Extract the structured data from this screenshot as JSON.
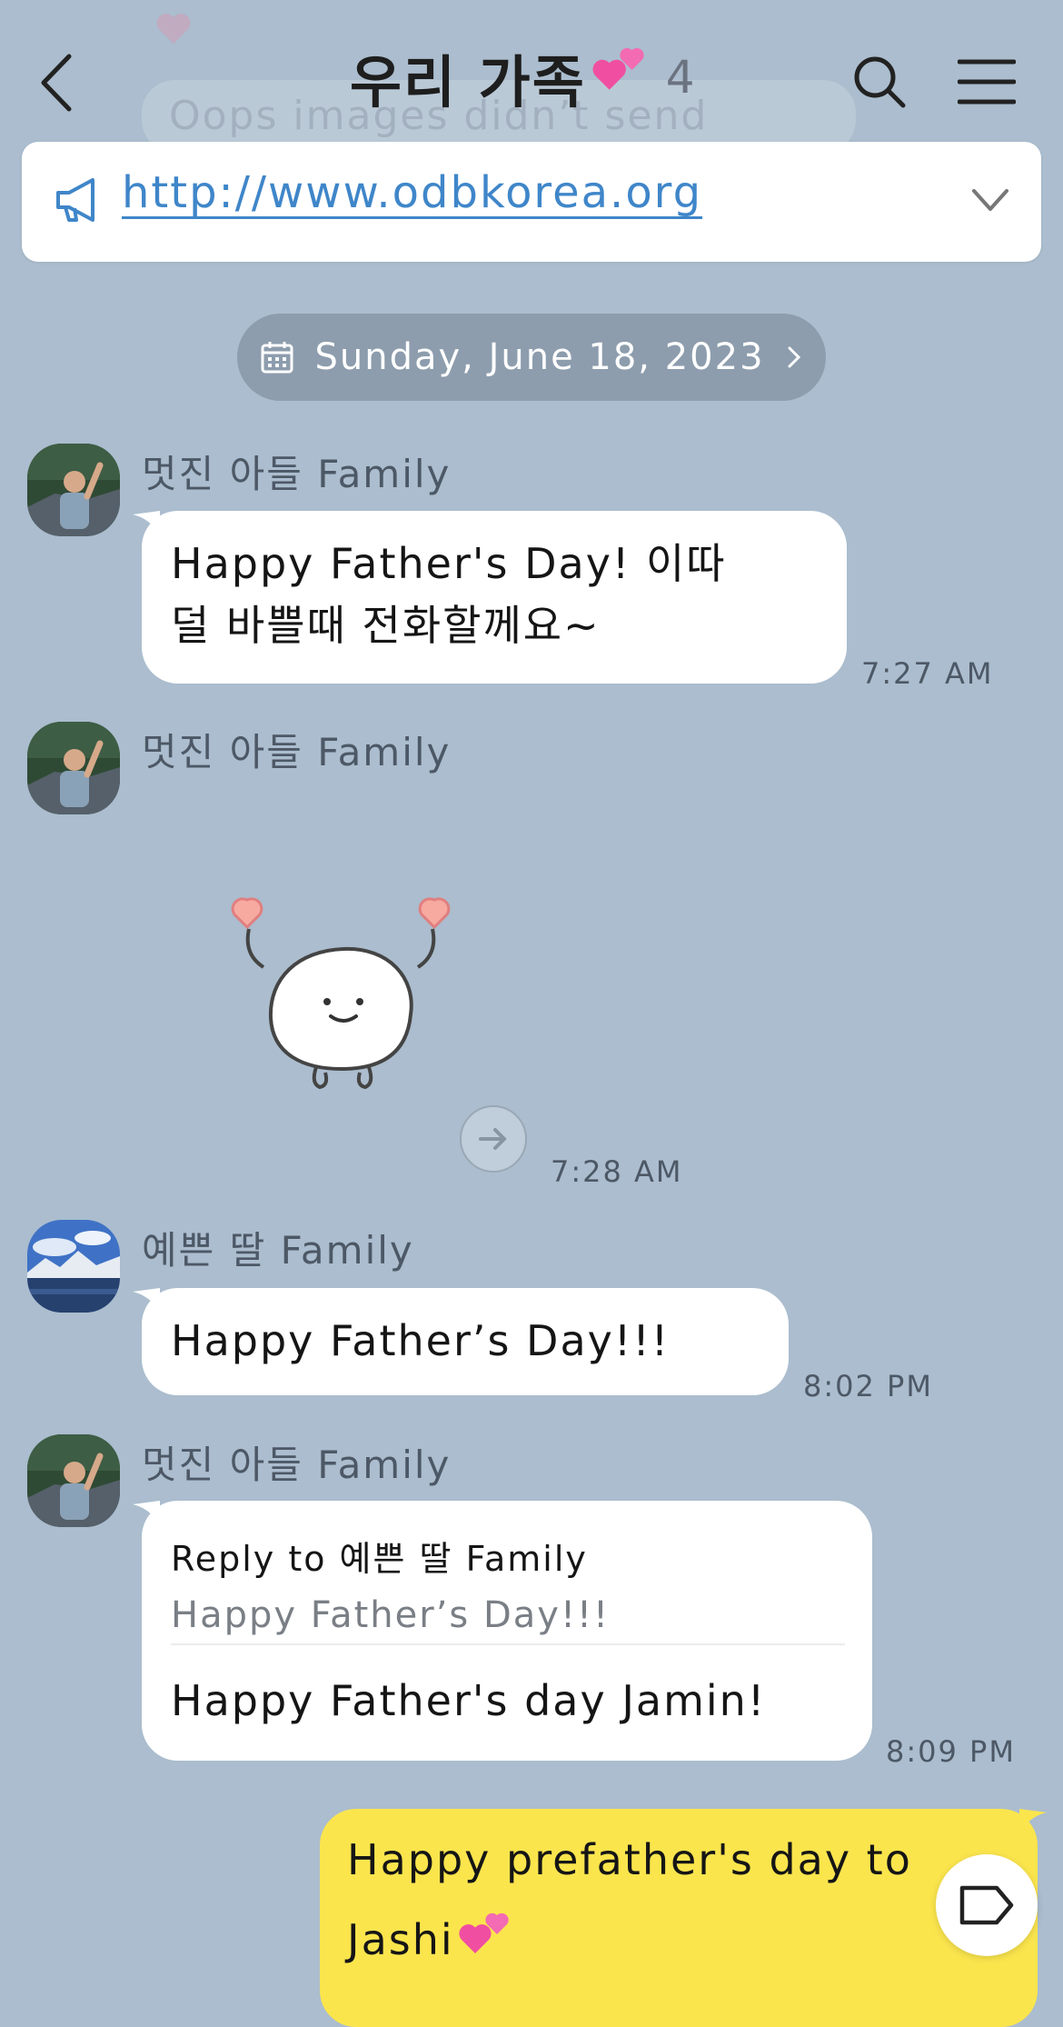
{
  "header": {
    "title": "우리 가족",
    "member_count": "4",
    "behind_text": "Oops images didn’t send"
  },
  "notice": {
    "link": "http://www.odbkorea.org"
  },
  "date_divider": {
    "label": "Sunday, June 18, 2023"
  },
  "messages": [
    {
      "sender": "멋진 아들 Family",
      "lines": [
        "Happy Father's Day! 이따",
        "덜 바쁠때 전화할께요~"
      ],
      "time": "7:27 AM"
    },
    {
      "sender": "멋진 아들 Family",
      "type": "sticker",
      "time": "7:28 AM"
    },
    {
      "sender": "예쁜 딸 Family",
      "text": "Happy Father’s Day!!!",
      "time": "8:02 PM"
    },
    {
      "sender": "멋진 아들 Family",
      "reply_to": "Reply to 예쁜 딸 Family",
      "reply_quote": "Happy Father’s Day!!!",
      "text": "Happy Father's day Jamin!",
      "time": "8:09 PM"
    }
  ],
  "my_message": {
    "line1": "Happy prefather's day to",
    "line2": "Jashi"
  },
  "colors": {
    "background": "#abbdce",
    "my_bubble": "#fbe54d",
    "link": "#3f86c9",
    "date_pill": "#8d9dad"
  },
  "icons": [
    "back-icon",
    "search-icon",
    "menu-icon",
    "megaphone-icon",
    "chevron-down-icon",
    "calendar-icon",
    "chevron-right-icon",
    "forward-icon",
    "tag-icon",
    "heart-emoji"
  ]
}
